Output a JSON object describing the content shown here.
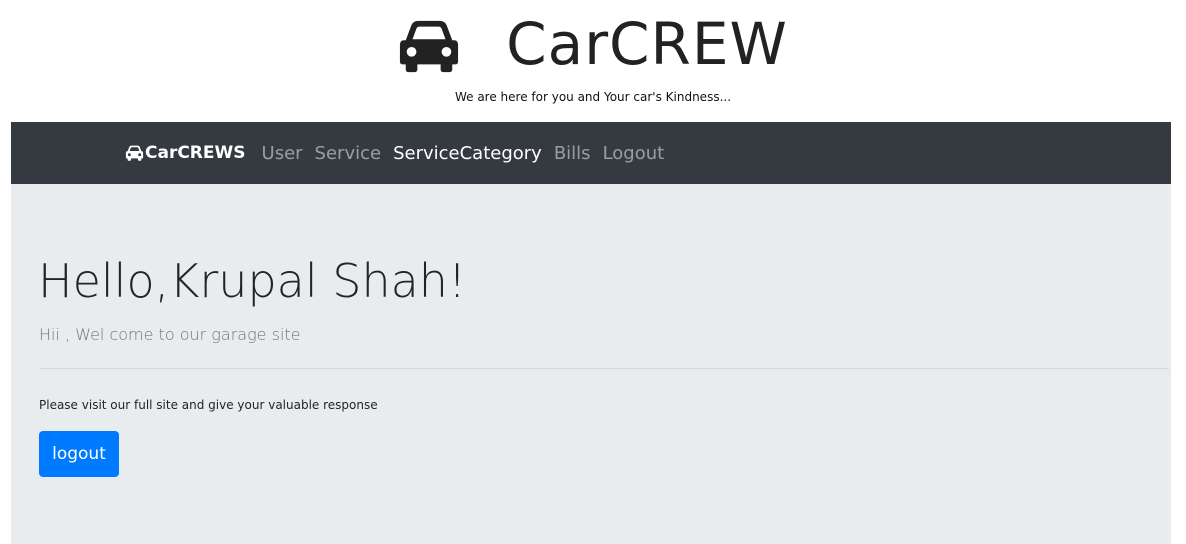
{
  "header": {
    "brand_title": "CarCREW",
    "brand_icon": "car-icon",
    "tagline": "We are here for you and Your car's Kindness..."
  },
  "navbar": {
    "brand_label": "CarCREWS",
    "brand_icon": "car-icon",
    "links": [
      {
        "label": "User",
        "active": false
      },
      {
        "label": "Service",
        "active": false
      },
      {
        "label": "ServiceCategory",
        "active": true
      },
      {
        "label": "Bills",
        "active": false
      },
      {
        "label": "Logout",
        "active": false
      }
    ]
  },
  "main": {
    "greeting": "Hello,Krupal Shah!",
    "lead": "Hii , Wel come to our garage site",
    "message": "Please visit our full site and give your valuable response",
    "logout_button": "logout"
  },
  "colors": {
    "navbar_bg": "#343a40",
    "jumbotron_bg": "#e9ecef",
    "button_primary": "#007bff"
  }
}
